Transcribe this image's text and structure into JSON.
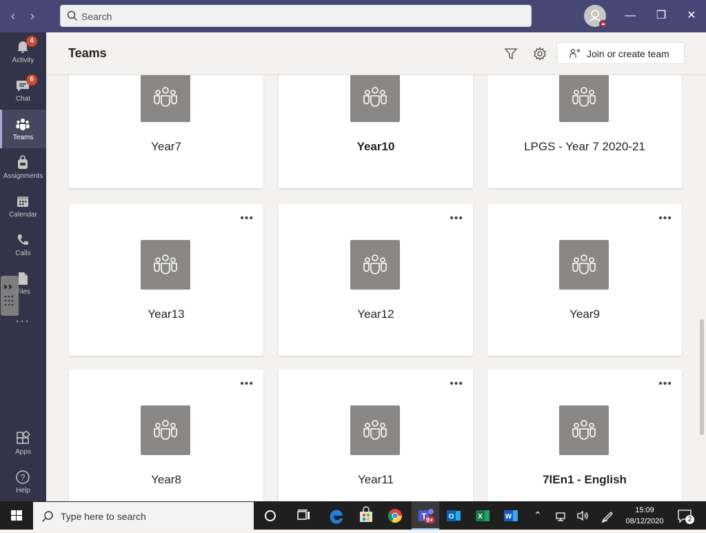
{
  "titlebar": {
    "search_placeholder": "Search"
  },
  "rail": {
    "items": [
      {
        "label": "Activity",
        "badge": "4"
      },
      {
        "label": "Chat",
        "badge": "6"
      },
      {
        "label": "Teams",
        "badge": ""
      },
      {
        "label": "Assignments",
        "badge": ""
      },
      {
        "label": "Calendar",
        "badge": ""
      },
      {
        "label": "Calls",
        "badge": ""
      },
      {
        "label": "Files",
        "badge": ""
      },
      {
        "label": "Apps",
        "badge": ""
      },
      {
        "label": "Help",
        "badge": ""
      }
    ],
    "more": "···"
  },
  "header": {
    "title": "Teams",
    "join_label": "Join or create team"
  },
  "teams": [
    {
      "name": "Year7",
      "bold": false
    },
    {
      "name": "Year10",
      "bold": true
    },
    {
      "name": "LPGS - Year 7 2020-21",
      "bold": false
    },
    {
      "name": "Year13",
      "bold": false
    },
    {
      "name": "Year12",
      "bold": false
    },
    {
      "name": "Year9",
      "bold": false
    },
    {
      "name": "Year8",
      "bold": false
    },
    {
      "name": "Year11",
      "bold": false
    },
    {
      "name": "7lEn1 - English",
      "bold": true
    }
  ],
  "taskbar": {
    "search_placeholder": "Type here to search",
    "time": "15:09",
    "date": "08/12/2020",
    "notifications": "2",
    "teams_badge": "9+"
  },
  "colors": {
    "titlebar": "#464775",
    "rail": "#33344a",
    "tile": "#8a8886"
  }
}
